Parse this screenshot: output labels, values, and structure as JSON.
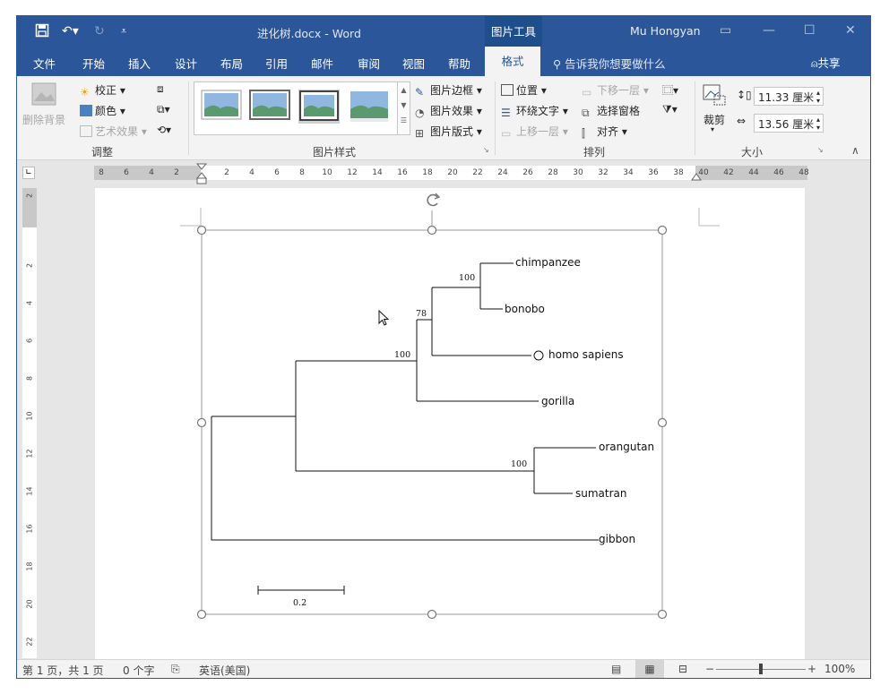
{
  "titlebar": {
    "doc_title": "进化树.docx  -  Word",
    "context_tool": "图片工具",
    "user": "Mu Hongyan"
  },
  "tabs": {
    "items": [
      "文件",
      "开始",
      "插入",
      "设计",
      "布局",
      "引用",
      "邮件",
      "审阅",
      "视图",
      "帮助"
    ],
    "active": "格式",
    "tell_me": "告诉我你想要做什么",
    "share": "共享"
  },
  "ribbon": {
    "remove_bg": "删除背景",
    "corrections": "校正",
    "color": "颜色",
    "artistic": "艺术效果",
    "group_adjust": "调整",
    "border": "图片边框",
    "effects": "图片效果",
    "layout": "图片版式",
    "group_styles": "图片样式",
    "position": "位置",
    "wrap_text": "环绕文字",
    "bring_forward": "上移一层",
    "send_backward": "下移一层",
    "selection_pane": "选择窗格",
    "align": "对齐",
    "group_arrange": "排列",
    "crop": "裁剪",
    "height": "11.33 厘米",
    "width": "13.56 厘米",
    "group_size": "大小"
  },
  "ruler": {
    "left_nums": [
      "8",
      "6",
      "4",
      "2"
    ],
    "nums": [
      "2",
      "4",
      "6",
      "8",
      "10",
      "12",
      "14",
      "16",
      "18",
      "20",
      "22",
      "24",
      "26",
      "28",
      "30",
      "32",
      "34",
      "36",
      "38",
      "40",
      "42",
      "44",
      "46",
      "48"
    ],
    "vnums": [
      "2",
      "2",
      "4",
      "6",
      "8",
      "10",
      "12",
      "14",
      "16",
      "18",
      "20",
      "22"
    ]
  },
  "tree": {
    "taxa": [
      "chimpanzee",
      "bonobo",
      "homo sapiens",
      "gorilla",
      "orangutan",
      "sumatran",
      "gibbon"
    ],
    "bootstrap": [
      "100",
      "78",
      "100",
      "100"
    ],
    "scale_label": "0.2"
  },
  "status": {
    "page": "第 1 页，共 1 页",
    "words": "0 个字",
    "language": "英语(美国)",
    "zoom": "100%"
  },
  "colors": {
    "word_blue": "#2b579a",
    "ribbon_bg": "#f3f3f3"
  }
}
